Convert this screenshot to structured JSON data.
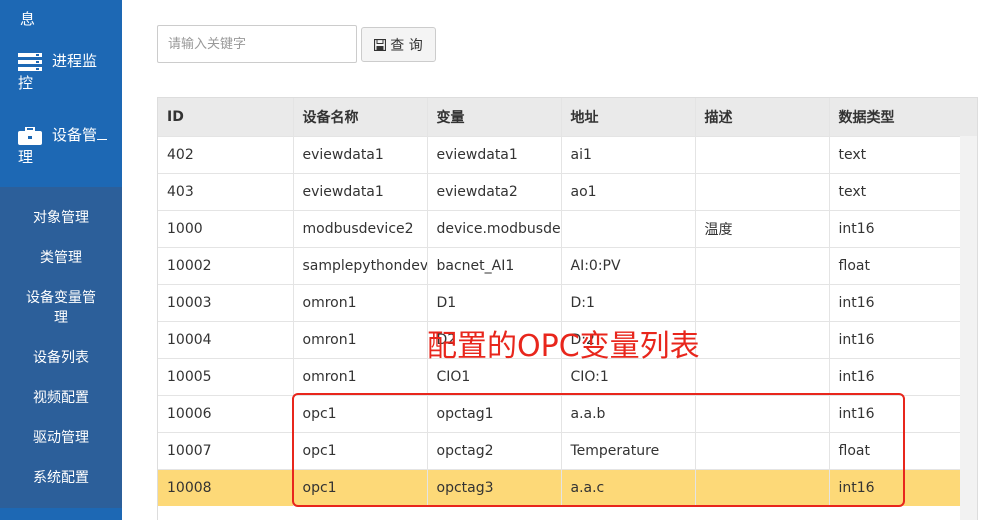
{
  "sidebar": {
    "info_label": "息",
    "process_label_a": "进程监",
    "process_label_b": "控",
    "device_label_a": "设备管",
    "device_label_b": "理",
    "sub_items": [
      {
        "label": "对象管理"
      },
      {
        "label": "类管理"
      },
      {
        "label": "设备变量管"
      },
      {
        "label": "理"
      },
      {
        "label": "设备列表"
      },
      {
        "label": "视频配置"
      },
      {
        "label": "驱动管理"
      },
      {
        "label": "系统配置"
      }
    ]
  },
  "search": {
    "placeholder": "请输入关键字",
    "button_label": "查 询"
  },
  "table": {
    "headers": [
      "ID",
      "设备名称",
      "变量",
      "地址",
      "描述",
      "数据类型"
    ],
    "rows": [
      [
        "402",
        "eviewdata1",
        "eviewdata1",
        "ai1",
        "",
        "text"
      ],
      [
        "403",
        "eviewdata1",
        "eviewdata2",
        "ao1",
        "",
        "text"
      ],
      [
        "1000",
        "modbusdevice2",
        "device.modbusdevic",
        "",
        "温度",
        "int16"
      ],
      [
        "10002",
        "samplepythondevice",
        "bacnet_AI1",
        "AI:0:PV",
        "",
        "float"
      ],
      [
        "10003",
        "omron1",
        "D1",
        "D:1",
        "",
        "int16"
      ],
      [
        "10004",
        "omron1",
        "D2",
        "D:2",
        "",
        "int16"
      ],
      [
        "10005",
        "omron1",
        "CIO1",
        "CIO:1",
        "",
        "int16"
      ],
      [
        "10006",
        "opc1",
        "opctag1",
        "a.a.b",
        "",
        "int16"
      ],
      [
        "10007",
        "opc1",
        "opctag2",
        "Temperature",
        "",
        "float"
      ],
      [
        "10008",
        "opc1",
        "opctag3",
        "a.a.c",
        "",
        "int16"
      ]
    ],
    "highlight_color": "#fdd978"
  },
  "annotation": {
    "text": "配置的OPC变量列表",
    "color": "#e8261c"
  }
}
